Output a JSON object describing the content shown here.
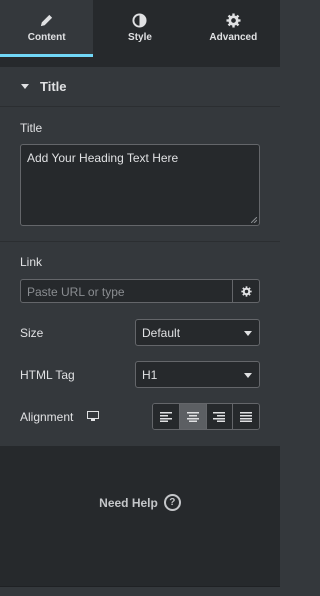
{
  "tabs": [
    {
      "label": "Content",
      "icon": "pencil-icon",
      "active": true
    },
    {
      "label": "Style",
      "icon": "contrast-icon",
      "active": false
    },
    {
      "label": "Advanced",
      "icon": "gear-icon",
      "active": false
    }
  ],
  "section": {
    "title": "Title"
  },
  "fields": {
    "title_label": "Title",
    "title_value": "Add Your Heading Text Here",
    "link_label": "Link",
    "link_placeholder": "Paste URL or type",
    "size_label": "Size",
    "size_value": "Default",
    "html_tag_label": "HTML Tag",
    "html_tag_value": "H1",
    "alignment_label": "Alignment",
    "alignment_options": [
      "left",
      "center",
      "right",
      "justify"
    ],
    "alignment_selected": "center"
  },
  "help": {
    "label": "Need Help",
    "icon": "?"
  },
  "colors": {
    "accent": "#71d7f7",
    "panel": "#34383c",
    "dark": "#26292c"
  }
}
